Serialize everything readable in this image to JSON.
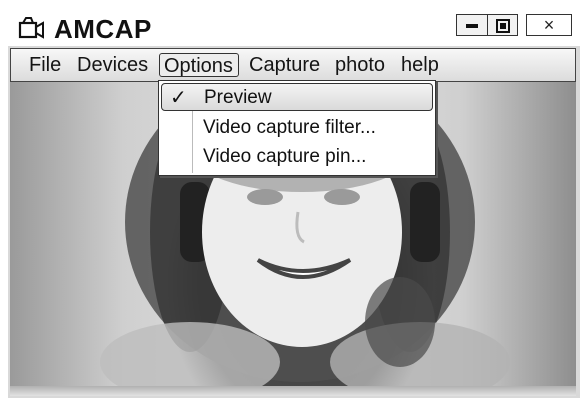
{
  "window": {
    "title": "AMCAP",
    "icon": "camera-icon",
    "controls": {
      "minimize": "minimize-icon",
      "maximize": "maximize-icon",
      "close": "×"
    }
  },
  "menubar": {
    "items": [
      {
        "label": "File"
      },
      {
        "label": "Devices"
      },
      {
        "label": "Options",
        "active": true
      },
      {
        "label": "Capture"
      },
      {
        "label": "photo"
      },
      {
        "label": "help"
      }
    ]
  },
  "options_menu": {
    "items": [
      {
        "label": "Preview",
        "checked": true,
        "check_glyph": "✓",
        "highlighted": true
      },
      {
        "label": "Video capture filter..."
      },
      {
        "label": "Video capture pin..."
      }
    ]
  }
}
